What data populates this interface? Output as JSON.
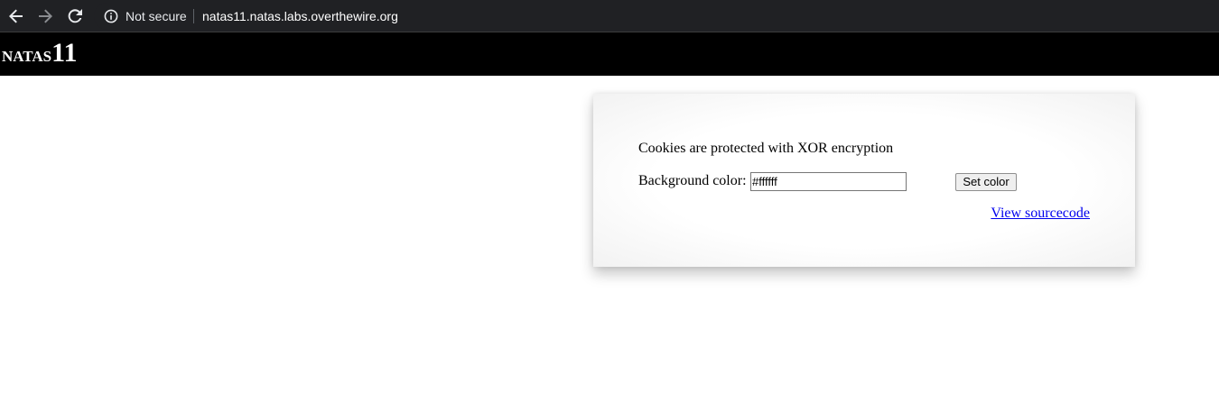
{
  "browser": {
    "security_label": "Not secure",
    "url": "natas11.natas.labs.overthewire.org",
    "icons": {
      "back": "back-arrow-icon",
      "forward": "forward-arrow-icon",
      "reload": "reload-icon",
      "info": "info-icon"
    },
    "colors": {
      "chrome_bg": "#202124",
      "text": "#e8eaed"
    }
  },
  "header": {
    "title_letters": "natas",
    "title_number": "11",
    "colors": {
      "bg": "#000000",
      "text": "#ffffff"
    }
  },
  "content": {
    "intro": "Cookies are protected with XOR encryption",
    "form": {
      "label": "Background color:",
      "value": "#ffffff",
      "button_label": "Set color"
    },
    "link_text": "View sourcecode",
    "colors": {
      "link": "#0000ee"
    }
  }
}
